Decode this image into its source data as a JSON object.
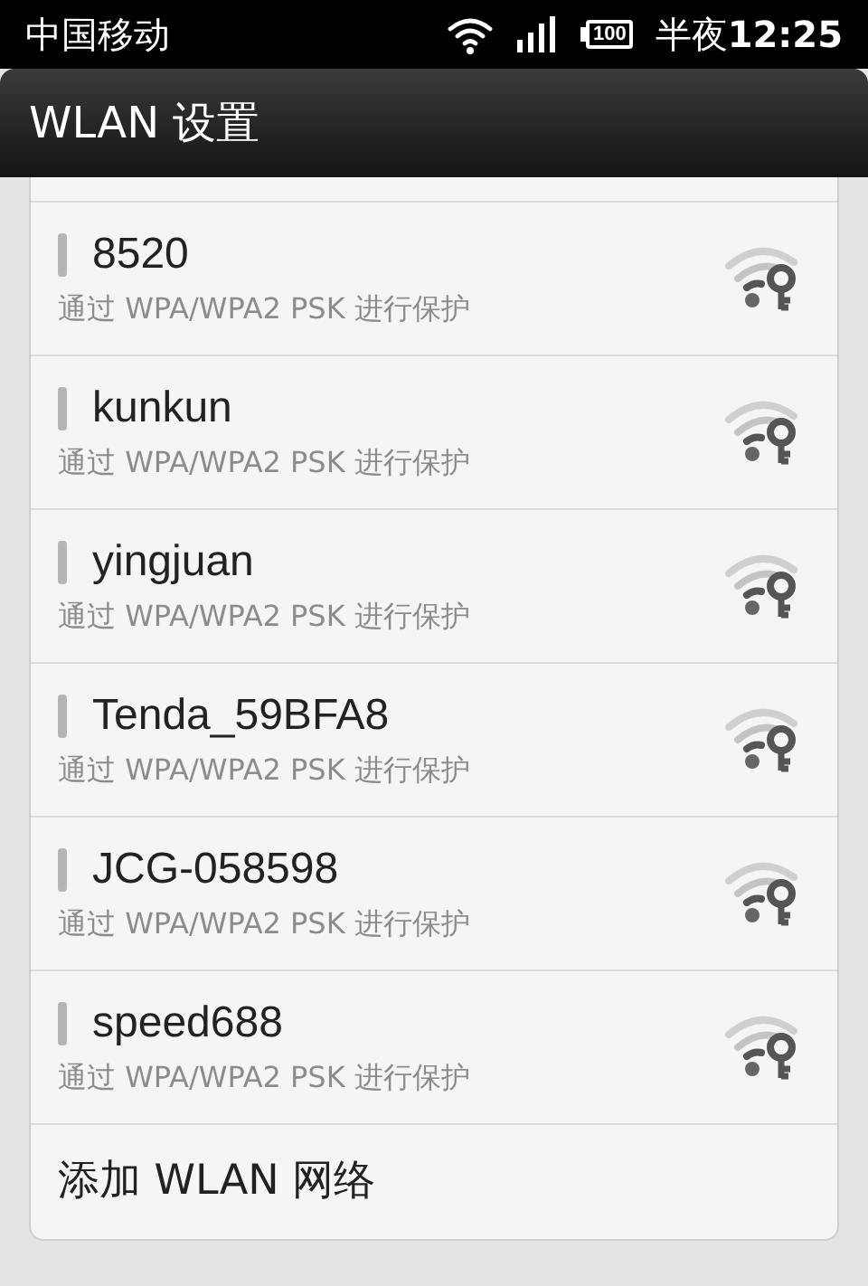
{
  "status_bar": {
    "carrier": "中国移动",
    "battery": "100",
    "time_prefix": "半夜",
    "time": "12:25"
  },
  "header": {
    "title": "WLAN 设置"
  },
  "networks": [
    {
      "name": "8520",
      "security": "通过 WPA/WPA2 PSK 进行保护"
    },
    {
      "name": "kunkun",
      "security": "通过 WPA/WPA2 PSK 进行保护"
    },
    {
      "name": "yingjuan",
      "security": "通过 WPA/WPA2 PSK 进行保护"
    },
    {
      "name": "Tenda_59BFA8",
      "security": "通过 WPA/WPA2 PSK 进行保护"
    },
    {
      "name": "JCG-058598",
      "security": "通过 WPA/WPA2 PSK 进行保护"
    },
    {
      "name": "speed688",
      "security": "通过 WPA/WPA2 PSK 进行保护"
    }
  ],
  "add_network": {
    "label": "添加 WLAN 网络"
  }
}
